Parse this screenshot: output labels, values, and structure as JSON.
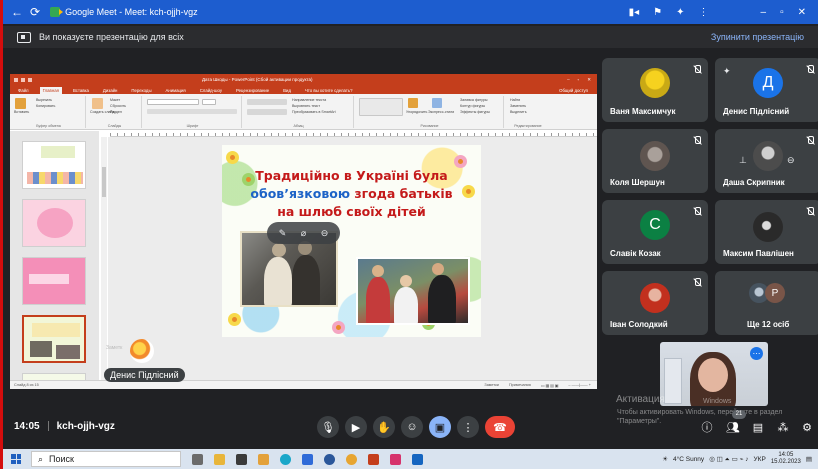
{
  "browser": {
    "tab_title": "Google Meet - Meet: kch-ojjh-vgz"
  },
  "presenting_bar": {
    "message": "Ви показуєте презентацію для всіх",
    "stop_label": "Зупинити презентацію"
  },
  "powerpoint": {
    "doc_title": "Дата Шкоды - PowerPoint (Сбой активации продукта)",
    "menu": [
      "Файл",
      "Главная",
      "Вставка",
      "Дизайн",
      "Переходы",
      "Анимация",
      "Слайд-шоу",
      "Рецензирование",
      "Вид",
      "Что вы хотите сделать?"
    ],
    "share": "Общий доступ",
    "ribbon_groups": [
      "Буфер обмена",
      "Слайды",
      "Шрифт",
      "Абзац",
      "Рисование",
      "Редактирование"
    ],
    "ribbon_items": [
      "Вырезать",
      "Копировать",
      "Вставить",
      "Создать слайд",
      "Макет",
      "Сбросить",
      "Раздел",
      "Направление текста",
      "Выровнять текст",
      "Преобразовать в SmartArt",
      "Упорядочить",
      "Экспресс-стили",
      "Заливка фигуры",
      "Контур фигуры",
      "Эффекты фигуры",
      "Найти",
      "Заменить",
      "Выделить"
    ],
    "status_left": "Слайд 8 из 15",
    "status_notes": "Заметки",
    "status_comments": "Примечания",
    "notes_placeholder": "Заметки к слайду",
    "slide": {
      "lines": [
        [
          "Традиційно в Україні була"
        ],
        [
          "обов’язковою",
          " згода батьків"
        ],
        [
          "на шлюб своїх дітей"
        ]
      ]
    }
  },
  "presenter": {
    "name": "Денис Підлісний",
    "caption_small": "Заметк"
  },
  "participants": [
    {
      "name": "Ваня Максимчук",
      "muted": true
    },
    {
      "name": "Денис Підлісний",
      "muted": true,
      "avatar_letter": "Д",
      "avatar_color": "#1a73e8"
    },
    {
      "name": "Коля Шершун",
      "muted": true
    },
    {
      "name": "Даша Скрипник",
      "muted": true
    },
    {
      "name": "Славік Козак",
      "muted": true,
      "avatar_letter": "С",
      "avatar_color": "#0b8043"
    },
    {
      "name": "Максим Павлішен",
      "muted": true
    },
    {
      "name": "Іван Солодкий",
      "muted": true
    },
    {
      "name": "Ще 12 осіб",
      "avatar_letter": "Р",
      "avatar_color": "#795548"
    }
  ],
  "self_view": {
    "label": "Windows"
  },
  "activation": {
    "title": "Активация",
    "text": "Чтобы активировать Windows, перейдите в раздел \"Параметры\"."
  },
  "meet_bar": {
    "time": "14:05",
    "meeting_code": "kch-ojjh-vgz",
    "participants_count": "21",
    "controls": [
      "microphone-icon",
      "camera-icon",
      "raise-hand-icon",
      "emoji-icon",
      "present-icon",
      "more-icon",
      "end-call-icon"
    ],
    "right_controls": [
      "info-icon",
      "people-icon",
      "chat-icon",
      "activities-icon",
      "host-controls-icon"
    ]
  },
  "taskbar": {
    "search": "Поиск",
    "weather": "4°C Sunny",
    "language": "УКР",
    "time": "14:05",
    "date": "15.02.2023"
  },
  "colors": {
    "meet_background": "#202124",
    "tile": "#3c4043",
    "accent_blue": "#8ab4f8",
    "end_call": "#ea4335",
    "powerpoint": "#c43e1c",
    "slide_red": "#c41a1a",
    "slide_blue": "#1d63c7"
  }
}
